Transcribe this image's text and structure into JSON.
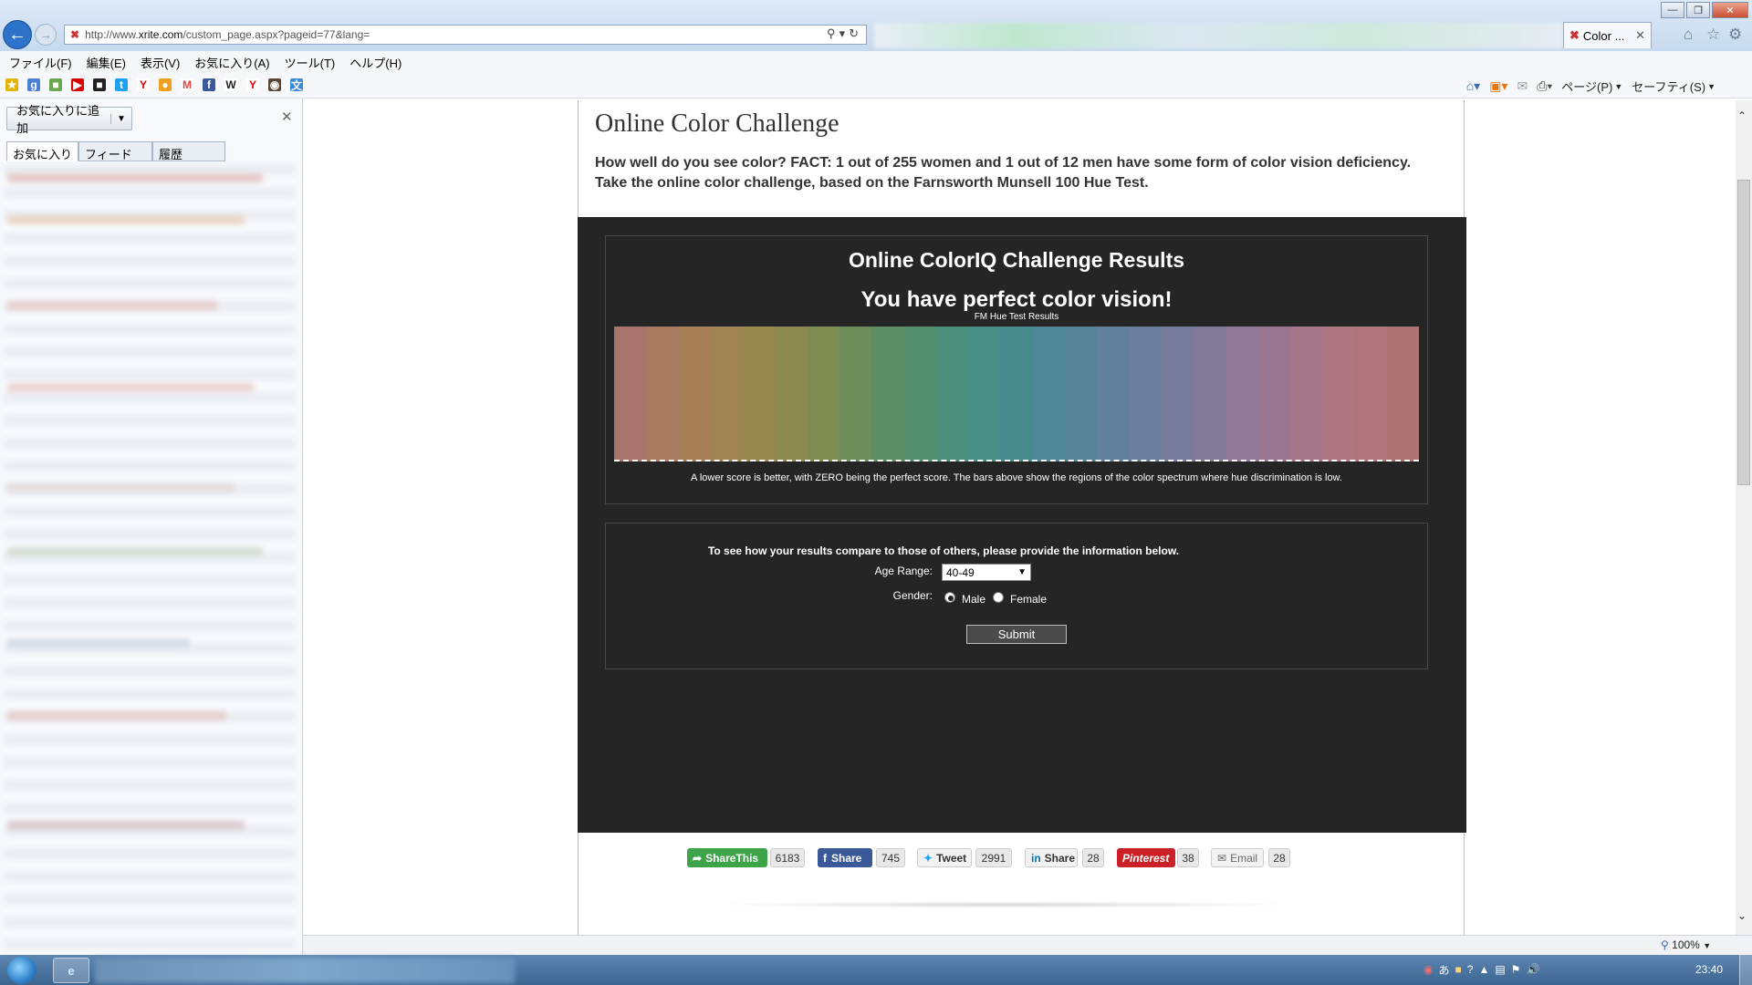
{
  "browser": {
    "address_prefix": "http://www.",
    "address_host": "xrite.com",
    "address_path": "/custom_page.aspx?pageid=77&lang=",
    "active_tab_title": "Color ...",
    "menu": [
      "ファイル(F)",
      "編集(E)",
      "表示(V)",
      "お気に入り(A)",
      "ツール(T)",
      "ヘルプ(H)"
    ],
    "command_bar": {
      "page_label": "ページ(P)",
      "safety_label": "セーフティ(S)"
    },
    "zoom": "100%"
  },
  "favorites_pane": {
    "add_button": "お気に入りに追加",
    "tabs": [
      "お気に入り",
      "フィード",
      "履歴"
    ]
  },
  "page": {
    "title": "Online Color Challenge",
    "intro": "How well do you see color? FACT: 1 out of 255 women and 1 out of 12 men have some form of color vision deficiency. Take the online color challenge, based on the Farnsworth Munsell 100 Hue Test.",
    "results_title": "Online ColorIQ Challenge Results",
    "results_subtitle": "You have perfect color vision!",
    "chart_title": "FM Hue Test Results",
    "chart_note": "A lower score is better, with ZERO being the perfect score. The bars above show the regions of the color spectrum where hue discrimination is low.",
    "form_intro": "To see how your results compare to those of others, please provide the information below.",
    "age_label": "Age Range:",
    "age_value": "40-49",
    "gender_label": "Gender:",
    "gender_male": "Male",
    "gender_female": "Female",
    "submit_label": "Submit"
  },
  "share_bar": {
    "sharethis_label": "ShareThis",
    "sharethis_count": "6183",
    "facebook_label": "Share",
    "facebook_count": "745",
    "twitter_label": "Tweet",
    "twitter_count": "2991",
    "linkedin_label": "Share",
    "linkedin_count": "28",
    "pinterest_label": "Pinterest",
    "pinterest_count": "38",
    "email_label": "Email",
    "email_count": "28"
  },
  "taskbar": {
    "clock": "23:40"
  },
  "colors": {
    "dark_panel": "#252525",
    "spectrum": [
      "#a8736a",
      "#a87a60",
      "#a67f57",
      "#a08452",
      "#98874f",
      "#8c8a4f",
      "#7e8c52",
      "#6e8d5a",
      "#5f8e64",
      "#528f70",
      "#4b8f7b",
      "#478e86",
      "#488b8e",
      "#4e8795",
      "#578399",
      "#61809c",
      "#6c7e9d",
      "#787c9c",
      "#837a9a",
      "#8e7896",
      "#997690",
      "#a5758a",
      "#ae7583",
      "#b0757c",
      "#ad7274"
    ]
  }
}
